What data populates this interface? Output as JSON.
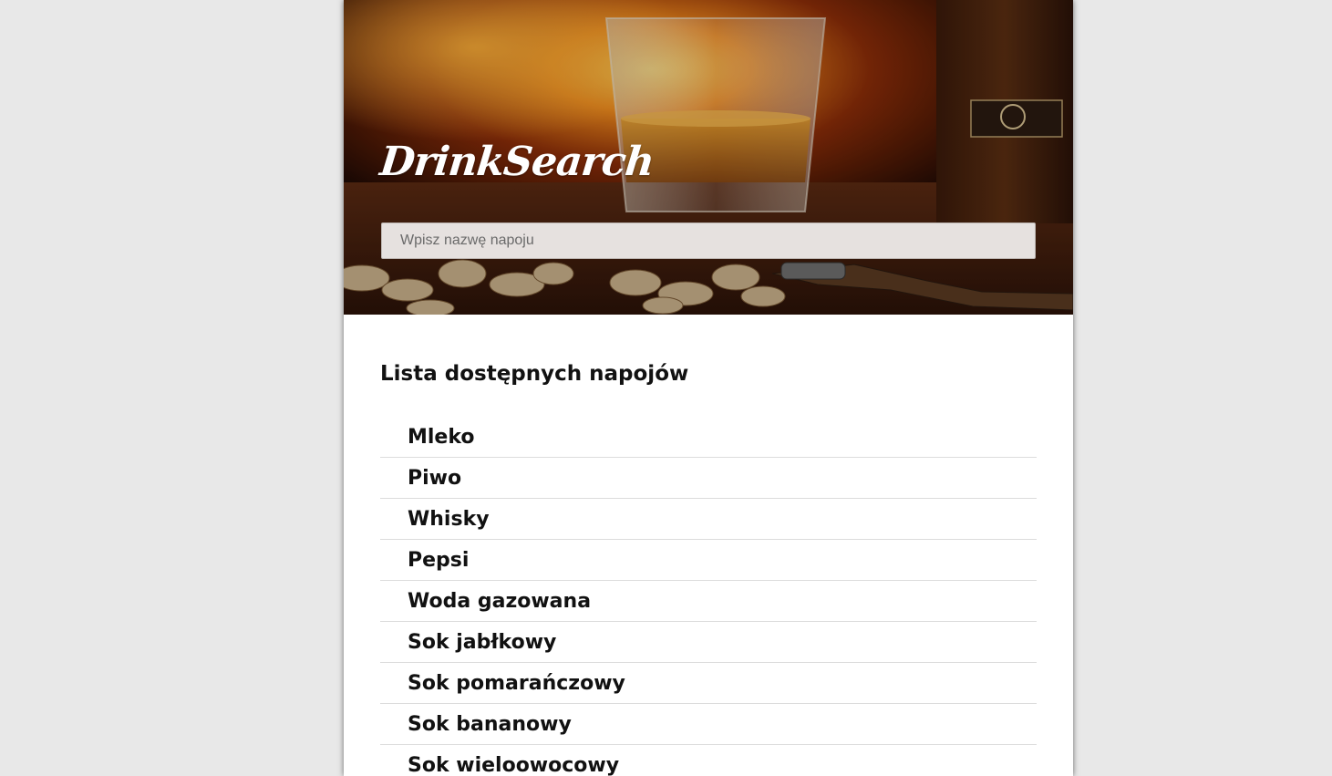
{
  "header": {
    "logo_text": "DrinkSearch",
    "search_placeholder": "Wpisz nazwę napoju"
  },
  "main": {
    "section_title": "Lista dostępnych napojów",
    "drinks": [
      "Mleko",
      "Piwo",
      "Whisky",
      "Pepsi",
      "Woda gazowana",
      "Sok jabłkowy",
      "Sok pomarańczowy",
      "Sok bananowy",
      "Sok wieloowocowy"
    ]
  },
  "colors": {
    "page_background": "#e8e8e8",
    "card_background": "#ffffff",
    "text": "#111111",
    "divider": "#dcdcdc",
    "search_background": "#e6e1df"
  }
}
